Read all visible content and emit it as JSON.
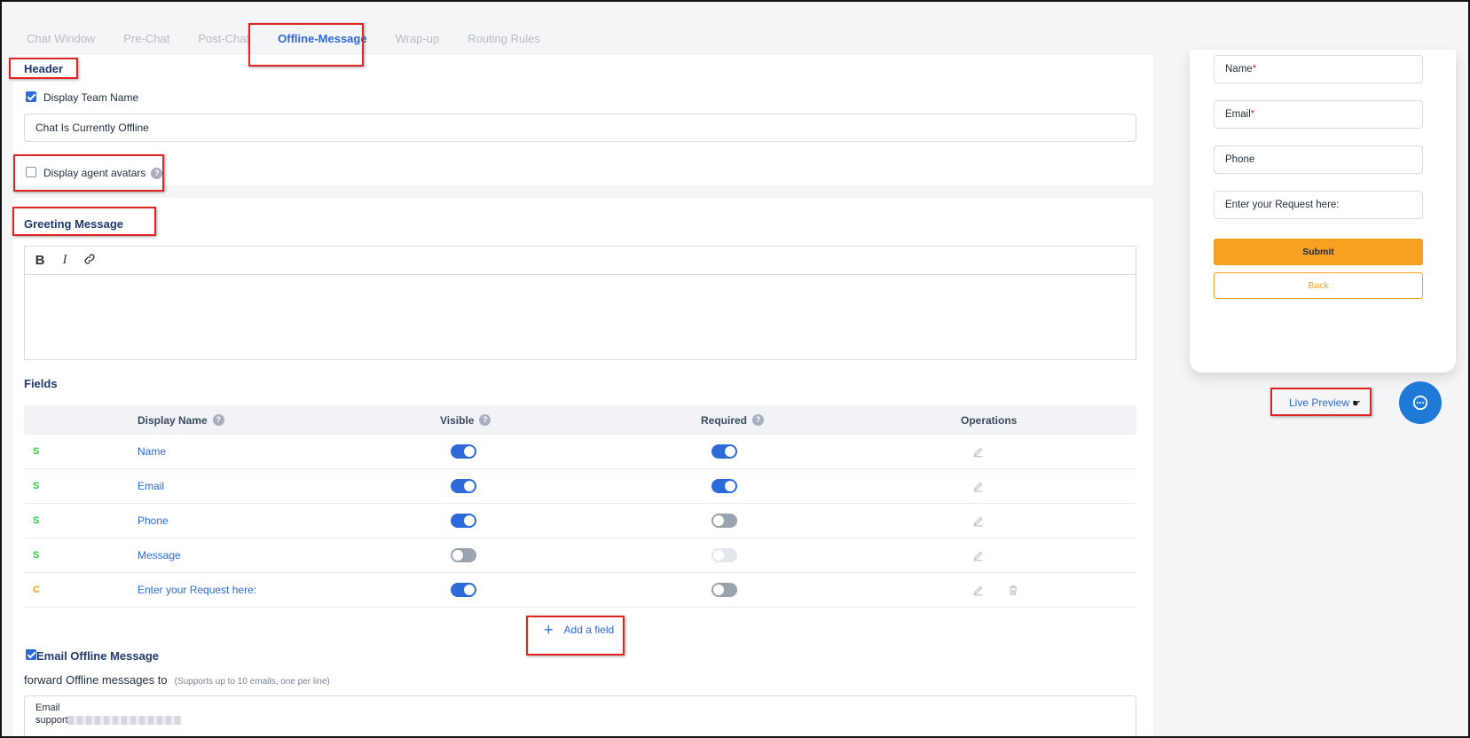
{
  "tabs": [
    {
      "label": "Chat Window",
      "active": false
    },
    {
      "label": "Pre-Chat",
      "active": false
    },
    {
      "label": "Post-Chat",
      "active": false
    },
    {
      "label": "Offline-Message",
      "active": true
    },
    {
      "label": "Wrap-up",
      "active": false
    },
    {
      "label": "Routing Rules",
      "active": false
    }
  ],
  "header": {
    "title": "Header",
    "display_team_name_label": "Display Team Name",
    "display_team_name_checked": true,
    "team_name_value": "Chat Is Currently Offline",
    "display_agent_avatars_label": "Display agent avatars",
    "display_agent_avatars_checked": false
  },
  "greeting": {
    "title": "Greeting Message",
    "toolbar": {
      "bold": "B",
      "italic": "I"
    },
    "value": ""
  },
  "fields": {
    "title": "Fields",
    "columns": {
      "display_name": "Display Name",
      "visible": "Visible",
      "required": "Required",
      "operations": "Operations"
    },
    "rows": [
      {
        "type": "S",
        "type_color": "#2ecc40",
        "name": "Name",
        "visible": "on",
        "required": "on",
        "deletable": false
      },
      {
        "type": "S",
        "type_color": "#2ecc40",
        "name": "Email",
        "visible": "on",
        "required": "on",
        "deletable": false
      },
      {
        "type": "S",
        "type_color": "#2ecc40",
        "name": "Phone",
        "visible": "on",
        "required": "off",
        "deletable": false
      },
      {
        "type": "S",
        "type_color": "#2ecc40",
        "name": "Message",
        "visible": "off",
        "required": "disabled",
        "deletable": false
      },
      {
        "type": "C",
        "type_color": "#f39c12",
        "name": "Enter your Request here:",
        "visible": "on",
        "required": "off",
        "deletable": true
      }
    ],
    "add_label": "Add a field"
  },
  "email_offline": {
    "label": "Email Offline Message",
    "checked": true,
    "forward_label": "forward Offline messages to",
    "forward_hint": "(Supports up to 10 emails, one per line)",
    "box_label": "Email",
    "box_value_prefix": "support"
  },
  "preview": {
    "fields": [
      {
        "label": "Name",
        "required": true
      },
      {
        "label": "Email",
        "required": true
      },
      {
        "label": "Phone",
        "required": false
      },
      {
        "label": "Enter your Request here:",
        "required": false
      }
    ],
    "submit_label": "Submit",
    "back_label": "Back",
    "live_preview_label": "Live Preview",
    "accent_color": "#f7a021"
  },
  "colors": {
    "primary": "#2b6ad8",
    "highlight_box": "#e02424"
  }
}
